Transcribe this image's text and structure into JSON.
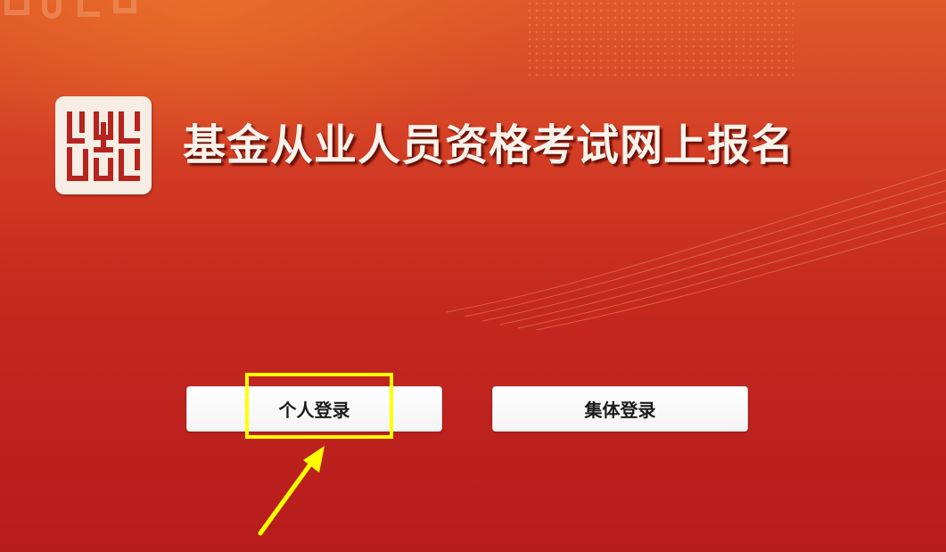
{
  "header": {
    "title": "基金从业人员资格考试网上报名",
    "logo_icon": "seal-logo-icon"
  },
  "login": {
    "personal_label": "个人登录",
    "group_label": "集体登录"
  },
  "annotation": {
    "highlight_color": "#ffff00",
    "arrow_color": "#ffff00"
  },
  "theme": {
    "background": "#c4281f",
    "title_color": "#fbf3ea"
  }
}
